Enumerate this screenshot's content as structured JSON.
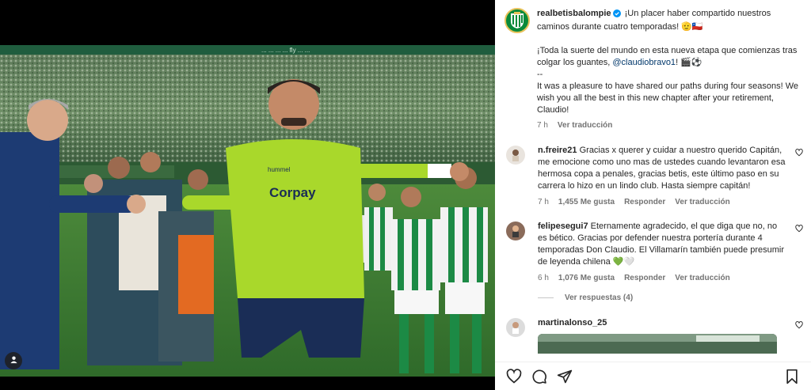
{
  "post": {
    "author": "realbetisbalompie",
    "caption_es_1": "¡Un placer haber compartido nuestros caminos durante cuatro temporadas! 🫡🇨🇱",
    "caption_es_2_pre": "¡Toda la suerte del mundo en esta nueva etapa que comienzas tras colgar los guantes, ",
    "caption_mention": "@claudiobravo1",
    "caption_es_2_post": "! 🎬⚽",
    "caption_sep": "--",
    "caption_en": "It was a pleasure to have shared our paths during four seasons! We wish you all the best in this new chapter after your retirement, Claudio!",
    "time": "7 h",
    "translate": "Ver traducción"
  },
  "photo": {
    "jersey_sponsor": "Corpay",
    "jersey_brand": "hummel",
    "banner_text": "... ... ... ... fly ... ..."
  },
  "comments": [
    {
      "user": "n.freire21",
      "text": "Gracias x querer y cuidar a nuestro querido Capitán, me emocione como uno mas de ustedes cuando levantaron esa hermosa copa a penales, gracias betis, este último paso en su carrera lo hizo en un lindo club. Hasta siempre capitán!",
      "time": "7 h",
      "likes": "1,455 Me gusta",
      "reply": "Responder",
      "translate": "Ver traducción"
    },
    {
      "user": "felipesegui7",
      "text": "Eternamente agradecido, el que diga que no, no es bético. Gracias por defender nuestra portería durante 4 temporadas Don Claudio. El Villamarín también puede presumir de leyenda chilena 💚🤍",
      "time": "6 h",
      "likes": "1,076 Me gusta",
      "reply": "Responder",
      "translate": "Ver traducción",
      "view_replies": "Ver respuestas (4)"
    },
    {
      "user": "martinalonso_25"
    }
  ],
  "icons": {
    "verified": "verified-badge-icon",
    "heart": "heart-icon",
    "comment": "comment-icon",
    "share": "share-icon",
    "save": "bookmark-icon",
    "user_tag": "user-tag-icon"
  },
  "colors": {
    "betis_green": "#0a8a3a",
    "jersey_lime": "#a9d82b",
    "verified_blue": "#0095f6",
    "mention": "#00376b",
    "meta_gray": "#737373"
  }
}
